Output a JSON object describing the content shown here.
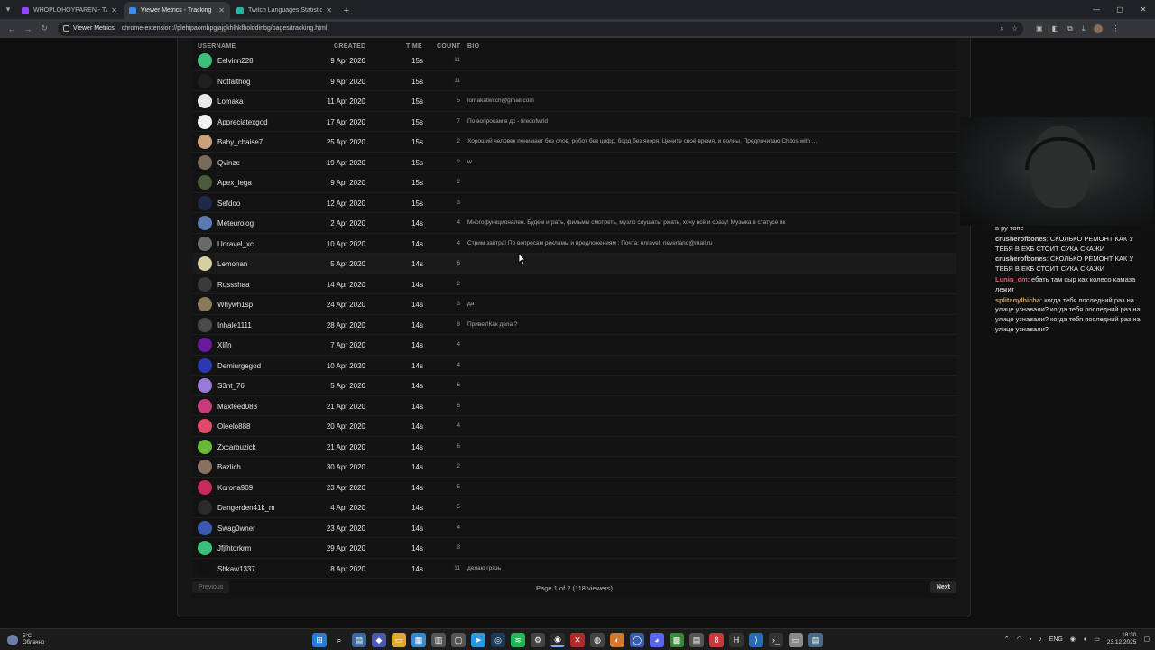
{
  "tabs": [
    {
      "title": "WHOPLOHOYPAREN - Twitch",
      "fav": "#9146ff",
      "active": false
    },
    {
      "title": "Viewer Metrics - Tracking",
      "fav": "#3a8ee6",
      "active": true
    },
    {
      "title": "Twitch Languages Statistics - Tw...",
      "fav": "#2bb3a0",
      "active": false
    }
  ],
  "toolbar": {
    "site_chip": "Viewer Metrics",
    "url": "chrome-extension://plehipaombpgjajgkhlhkfbolddinbg/pages/tracking.html"
  },
  "table": {
    "headers": {
      "username": "USERNAME",
      "created": "CREATED",
      "time": "TIME",
      "count": "COUNT",
      "bio": "BIO"
    },
    "rows": [
      {
        "username": "Eelvinn228",
        "created": "9 Apr 2020",
        "time": "15s",
        "count": "11",
        "bio": "",
        "avatar": "#3bbf7a"
      },
      {
        "username": "Notfaithog",
        "created": "9 Apr 2020",
        "time": "15s",
        "count": "11",
        "bio": "",
        "avatar": "#202020"
      },
      {
        "username": "Lomaka",
        "created": "11 Apr 2020",
        "time": "15s",
        "count": "5",
        "bio": "lomakatwitch@gmail.com",
        "avatar": "#e8e8e8"
      },
      {
        "username": "Appreciatexgod",
        "created": "17 Apr 2020",
        "time": "15s",
        "count": "7",
        "bio": "По вопросам в дс - tiredofwrld",
        "avatar": "#f2f2f2"
      },
      {
        "username": "Baby_chaise7",
        "created": "25 Apr 2020",
        "time": "15s",
        "count": "2",
        "bio": "Хороший человек понимает без слов, робот без цифр, борд без якоря. Цените своё время, и волны. Предпочитаю Chitos with ...",
        "avatar": "#c9a27a"
      },
      {
        "username": "Qvinze",
        "created": "19 Apr 2020",
        "time": "15s",
        "count": "2",
        "bio": "w",
        "avatar": "#7a6a5a"
      },
      {
        "username": "Apex_lega",
        "created": "9 Apr 2020",
        "time": "15s",
        "count": "2",
        "bio": "",
        "avatar": "#4a5a3a"
      },
      {
        "username": "Sefdoo",
        "created": "12 Apr 2020",
        "time": "15s",
        "count": "3",
        "bio": "",
        "avatar": "#1e2a4a"
      },
      {
        "username": "Meteurolog",
        "created": "2 Apr 2020",
        "time": "14s",
        "count": "4",
        "bio": "Многофункционален. Будем играть, фильмы смотреть, музло слушать, ржать, хочу всё и сразу! Музыка в статусе вк",
        "avatar": "#5a7ab0"
      },
      {
        "username": "Unravel_xc",
        "created": "10 Apr 2020",
        "time": "14s",
        "count": "4",
        "bio": "Стрим завтра! По вопросам рекламы и предложениям : Почта: unravel_neverland@mail.ru",
        "avatar": "#6a6a6a"
      },
      {
        "username": "Lemonan",
        "created": "5 Apr 2020",
        "time": "14s",
        "count": "6",
        "bio": "",
        "avatar": "#d8cfa0",
        "hl": true
      },
      {
        "username": "Russshaa",
        "created": "14 Apr 2020",
        "time": "14s",
        "count": "2",
        "bio": "",
        "avatar": "#3a3a3a"
      },
      {
        "username": "Whywh1sp",
        "created": "24 Apr 2020",
        "time": "14s",
        "count": "3",
        "bio": "да",
        "avatar": "#8a7a5a"
      },
      {
        "username": "Inhale1111",
        "created": "28 Apr 2020",
        "time": "14s",
        "count": "8",
        "bio": "Привет!Как дела ?",
        "avatar": "#4a4a4a"
      },
      {
        "username": "Xlifn",
        "created": "7 Apr 2020",
        "time": "14s",
        "count": "4",
        "bio": "",
        "avatar": "#6a1a9a"
      },
      {
        "username": "Demiurgegod",
        "created": "10 Apr 2020",
        "time": "14s",
        "count": "4",
        "bio": "",
        "avatar": "#2a3ab0"
      },
      {
        "username": "S3nt_76",
        "created": "5 Apr 2020",
        "time": "14s",
        "count": "6",
        "bio": "",
        "avatar": "#9a7ad8"
      },
      {
        "username": "Maxfeed083",
        "created": "21 Apr 2020",
        "time": "14s",
        "count": "6",
        "bio": "",
        "avatar": "#c83a7a"
      },
      {
        "username": "Oleelo888",
        "created": "20 Apr 2020",
        "time": "14s",
        "count": "4",
        "bio": "",
        "avatar": "#e04a6a"
      },
      {
        "username": "Zxcarbuzick",
        "created": "21 Apr 2020",
        "time": "14s",
        "count": "6",
        "bio": "",
        "avatar": "#6ab83a"
      },
      {
        "username": "Bazlich",
        "created": "30 Apr 2020",
        "time": "14s",
        "count": "2",
        "bio": "",
        "avatar": "#8a7060"
      },
      {
        "username": "Korona909",
        "created": "23 Apr 2020",
        "time": "14s",
        "count": "5",
        "bio": "",
        "avatar": "#c82a5a"
      },
      {
        "username": "Dangerden41k_m",
        "created": "4 Apr 2020",
        "time": "14s",
        "count": "5",
        "bio": "",
        "avatar": "#2a2a2a"
      },
      {
        "username": "Swag0wner",
        "created": "23 Apr 2020",
        "time": "14s",
        "count": "4",
        "bio": "",
        "avatar": "#3a5ab0"
      },
      {
        "username": "Jfjfhtorkrm",
        "created": "29 Apr 2020",
        "time": "14s",
        "count": "3",
        "bio": "",
        "avatar": "#3bbf7a"
      },
      {
        "username": "Shkaw1337",
        "created": "8 Apr 2020",
        "time": "14s",
        "count": "11",
        "bio": "делаю грязь",
        "avatar": "#111111"
      }
    ]
  },
  "pager": {
    "prev": "Previous",
    "info": "Page 1 of 2 (118 viewers)",
    "next": "Next"
  },
  "chat": [
    {
      "name": "",
      "text": "в ру топе",
      "color": "#e8e8e8"
    },
    {
      "name": "crusherofbones",
      "text": "СКОЛЬКО РЕМОНТ КАК У ТЕБЯ В ЕКБ СТОИТ СУКА СКАЖИ",
      "color": "#d0d0d0"
    },
    {
      "name": "crusherofbones",
      "text": "СКОЛЬКО РЕМОНТ КАК У ТЕБЯ В ЕКБ СТОИТ СУКА СКАЖИ",
      "color": "#d0d0d0"
    },
    {
      "name": "Lunin_dm",
      "text": "ебать там сыр как колесо камаза лежит",
      "color": "#e05a6a"
    },
    {
      "name": "splitanylbicha",
      "text": "когда тебя последний раз на улице узнавали? когда тебя последний раз на улице узнавали? когда тебя последний раз на улице узнавали?",
      "color": "#c9a26a"
    }
  ],
  "taskbar": {
    "temp": "5°C",
    "condition": "Облачно",
    "lang": "ENG",
    "time": "18:30",
    "date": "23.12.2025"
  }
}
